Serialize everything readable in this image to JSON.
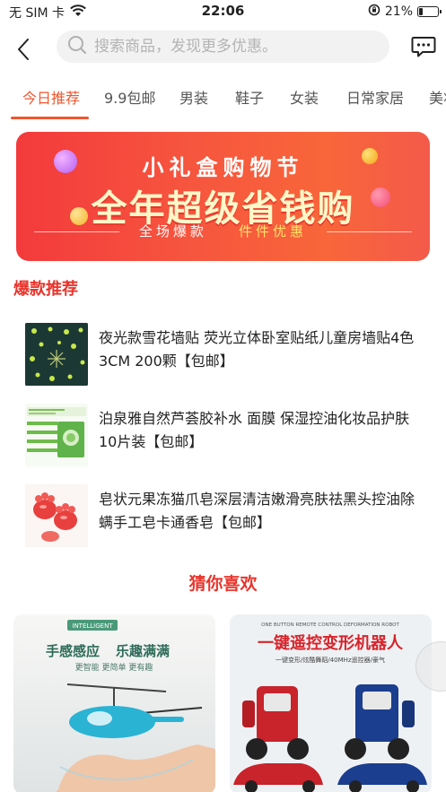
{
  "status_bar": {
    "carrier": "无 SIM 卡",
    "time": "22:06",
    "battery_percent": "21%",
    "battery_level": 0.21
  },
  "nav": {
    "search_placeholder": "搜索商品，发现更多优惠。"
  },
  "tabs": [
    {
      "label": "今日推荐",
      "active": true
    },
    {
      "label": "9.9包邮"
    },
    {
      "label": "男装"
    },
    {
      "label": "鞋子"
    },
    {
      "label": "女装"
    },
    {
      "label": "日常家居"
    },
    {
      "label": "美妆"
    }
  ],
  "banner": {
    "title": "小礼盒购物节",
    "headline": "全年超级省钱购",
    "sub_left": "全场爆款",
    "sub_right": "件件优惠"
  },
  "hot_section": {
    "title": "爆款推荐",
    "items": [
      {
        "title": "夜光款雪花墙贴 荧光立体卧室贴纸儿童房墙贴4色3CM 200颗【包邮】"
      },
      {
        "title": "泊泉雅自然芦荟胶补水 面膜 保湿控油化妆品护肤 10片装【包邮】"
      },
      {
        "title": "皂状元果冻猫爪皂深层清洁嫩滑亮肤祛黑头控油除螨手工皂卡通香皂【包邮】"
      }
    ]
  },
  "guess_section": {
    "title": "猜你喜欢",
    "cards": [
      {
        "badge": "INTELLIGENT",
        "headline_a": "手感感应",
        "headline_b": "乐趣满满",
        "sub": "更智能 更简单 更有趣"
      },
      {
        "top_text": "ONE BUTTON REMOTE CONTROL DEFORMATION ROBOT",
        "headline": "一键遥控变形机器人",
        "sub": "一键变形/炫酷舞蹈/40MHz遥控器/豪气"
      }
    ]
  },
  "colors": {
    "accent": "#f0562e",
    "section_red": "#e8352c"
  }
}
